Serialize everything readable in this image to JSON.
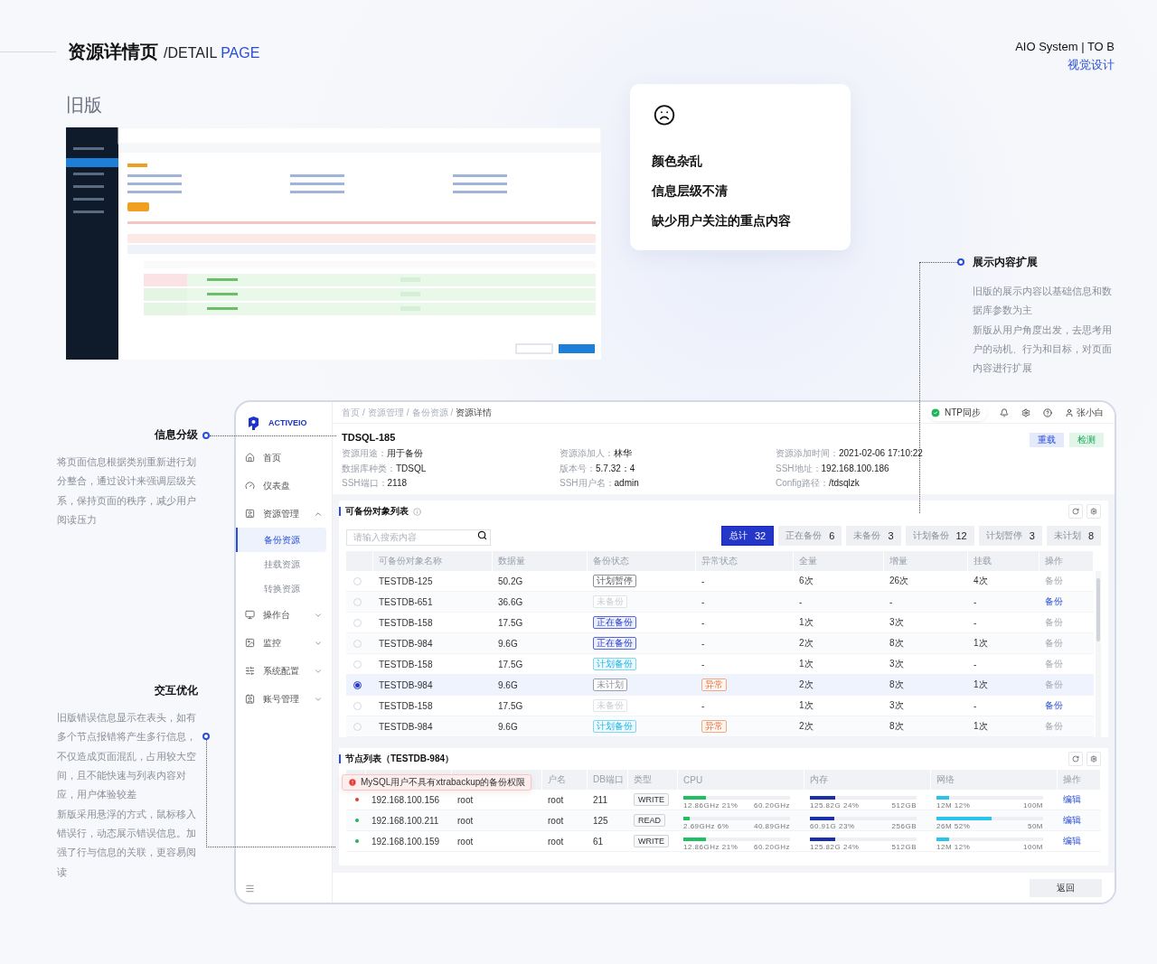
{
  "header": {
    "title": "资源详情页",
    "subtitle": "/DETAIL ",
    "subtitle_accent": "PAGE",
    "brand": "AIO System | TO B",
    "brand_sub": "视觉设计"
  },
  "old_version": {
    "label": "旧版"
  },
  "pain_points": [
    "颜色杂乱",
    "信息层级不清",
    "缺少用户关注的重点内容"
  ],
  "annotations": [
    {
      "title": "展示内容扩展",
      "paragraphs": [
        "旧版的展示内容以基础信息和数据库参数为主",
        "新版从用户角度出发，去思考用户的动机、行为和目标，对页面内容进行扩展"
      ]
    },
    {
      "title": "信息分级",
      "paragraphs": [
        "将页面信息根据类别重新进行划分整合，通过设计来强调层级关系，保持页面的秩序，减少用户阅读压力"
      ]
    },
    {
      "title": "交互优化",
      "paragraphs": [
        "旧版错误信息显示在表头，如有多个节点报错将产生多行信息，不仅造成页面混乱，占用较大空间，且不能快速与列表内容对应，用户体验较差",
        "新版采用悬浮的方式，鼠标移入错误行，动态展示错误信息。加强了行与信息的关联，更容易阅读"
      ]
    }
  ],
  "app": {
    "logo": "ACTIVEIO",
    "nav": [
      {
        "label": "首页",
        "kind": "item"
      },
      {
        "label": "仪表盘",
        "kind": "item"
      },
      {
        "label": "资源管理",
        "kind": "group",
        "expanded": true,
        "children": [
          {
            "label": "备份资源",
            "selected": true
          },
          {
            "label": "挂载资源",
            "selected": false
          },
          {
            "label": "转换资源",
            "selected": false
          }
        ]
      },
      {
        "label": "操作台",
        "kind": "group",
        "expanded": false
      },
      {
        "label": "监控",
        "kind": "group",
        "expanded": false
      },
      {
        "label": "系统配置",
        "kind": "group",
        "expanded": false
      },
      {
        "label": "账号管理",
        "kind": "group",
        "expanded": false
      }
    ],
    "breadcrumb": {
      "separator": "/",
      "items": [
        "首页",
        "资源管理",
        "备份资源",
        "资源详情"
      ]
    },
    "topbar": {
      "ntp": "NTP同步",
      "user": "张小白"
    },
    "resource": {
      "title": "TDSQL-185",
      "fields": [
        {
          "label": "资源用途：",
          "value": "用于备份"
        },
        {
          "label": "资源添加人：",
          "value": "林华"
        },
        {
          "label": "资源添加时间：",
          "value": "2021-02-06 17:10:22"
        },
        {
          "label": "数据库种类：",
          "value": "TDSQL"
        },
        {
          "label": "版本号：",
          "value": "5.7.32：4"
        },
        {
          "label": "SSH地址：",
          "value": "192.168.100.186"
        },
        {
          "label": "SSH端口：",
          "value": "2118"
        },
        {
          "label": "SSH用户名：",
          "value": "admin"
        },
        {
          "label": "Config路径：",
          "value": "/tdsqlzk"
        }
      ],
      "actions": [
        {
          "label": "重载",
          "kind": "primary"
        },
        {
          "label": "检测",
          "kind": "success"
        }
      ]
    },
    "backup_list": {
      "title": "可备份对象列表",
      "search": {
        "placeholder": "请输入搜索内容"
      },
      "filters": [
        {
          "label": "总计",
          "count": "32",
          "selected": true
        },
        {
          "label": "正在备份",
          "count": "6",
          "selected": false
        },
        {
          "label": "未备份",
          "count": "3",
          "selected": false
        },
        {
          "label": "计划备份",
          "count": "12",
          "selected": false
        },
        {
          "label": "计划暂停",
          "count": "3",
          "selected": false
        },
        {
          "label": "未计划",
          "count": "8",
          "selected": false
        }
      ],
      "columns": [
        "可备份对象名称",
        "数据量",
        "备份状态",
        "异常状态",
        "全量",
        "增量",
        "挂载",
        "操作"
      ],
      "rows": [
        {
          "selected": false,
          "name": "TESTDB-125",
          "size": "50.2G",
          "status": {
            "label": "计划暂停",
            "kind": "paused"
          },
          "anomaly": {
            "label": "-",
            "kind": "text"
          },
          "full": "6次",
          "inc": "26次",
          "mount": "4次",
          "action": {
            "label": "备份",
            "disabled": true
          }
        },
        {
          "selected": false,
          "name": "TESTDB-651",
          "size": "36.6G",
          "status": {
            "label": "未备份",
            "kind": "none"
          },
          "anomaly": {
            "label": "-",
            "kind": "text"
          },
          "full": "-",
          "inc": "-",
          "mount": "-",
          "action": {
            "label": "备份",
            "disabled": false
          }
        },
        {
          "selected": false,
          "name": "TESTDB-158",
          "size": "17.5G",
          "status": {
            "label": "正在备份",
            "kind": "running"
          },
          "anomaly": {
            "label": "-",
            "kind": "text"
          },
          "full": "1次",
          "inc": "3次",
          "mount": "-",
          "action": {
            "label": "备份",
            "disabled": true
          }
        },
        {
          "selected": false,
          "name": "TESTDB-984",
          "size": "9.6G",
          "status": {
            "label": "正在备份",
            "kind": "running"
          },
          "anomaly": {
            "label": "-",
            "kind": "text"
          },
          "full": "2次",
          "inc": "8次",
          "mount": "1次",
          "action": {
            "label": "备份",
            "disabled": true
          }
        },
        {
          "selected": false,
          "name": "TESTDB-158",
          "size": "17.5G",
          "status": {
            "label": "计划备份",
            "kind": "planned"
          },
          "anomaly": {
            "label": "-",
            "kind": "text"
          },
          "full": "1次",
          "inc": "3次",
          "mount": "-",
          "action": {
            "label": "备份",
            "disabled": true
          }
        },
        {
          "selected": true,
          "name": "TESTDB-984",
          "size": "9.6G",
          "status": {
            "label": "未计划",
            "kind": "unplanned"
          },
          "anomaly": {
            "label": "异常",
            "kind": "tag"
          },
          "full": "2次",
          "inc": "8次",
          "mount": "1次",
          "action": {
            "label": "备份",
            "disabled": true
          }
        },
        {
          "selected": false,
          "name": "TESTDB-158",
          "size": "17.5G",
          "status": {
            "label": "未备份",
            "kind": "none"
          },
          "anomaly": {
            "label": "-",
            "kind": "text"
          },
          "full": "1次",
          "inc": "3次",
          "mount": "-",
          "action": {
            "label": "备份",
            "disabled": false
          }
        },
        {
          "selected": false,
          "name": "TESTDB-984",
          "size": "9.6G",
          "status": {
            "label": "计划备份",
            "kind": "planned"
          },
          "anomaly": {
            "label": "异常",
            "kind": "tag"
          },
          "full": "2次",
          "inc": "8次",
          "mount": "1次",
          "action": {
            "label": "备份",
            "disabled": true
          }
        }
      ]
    },
    "node_list": {
      "title": "节点列表（TESTDB-984）",
      "tooltip": "MySQL用户不具有xtrabackup的备份权限",
      "columns": [
        "户名",
        "DB端口",
        "类型",
        "CPU",
        "内存",
        "网络",
        "操作"
      ],
      "rows": [
        {
          "color": "#e53935",
          "ip": "192.168.100.156",
          "user": "root",
          "db_user": "root",
          "port": "211",
          "type": "WRITE",
          "cpu": {
            "level": 0.21,
            "used": "12.86GHz",
            "pct": "21%",
            "total": "60.20GHz"
          },
          "mem": {
            "level": 0.24,
            "used": "125.82G",
            "pct": "24%",
            "total": "512GB"
          },
          "net": {
            "level": 0.12,
            "used": "12M",
            "pct": "12%",
            "total": "100M"
          },
          "action": "编辑"
        },
        {
          "color": "#22b35e",
          "ip": "192.168.100.211",
          "user": "root",
          "db_user": "root",
          "port": "125",
          "type": "READ",
          "cpu": {
            "level": 0.06,
            "used": "2.69GHz",
            "pct": "6%",
            "total": "40.89GHz"
          },
          "mem": {
            "level": 0.23,
            "used": "60.91G",
            "pct": "23%",
            "total": "256GB"
          },
          "net": {
            "level": 0.52,
            "used": "26M",
            "pct": "52%",
            "total": "50M"
          },
          "action": "编辑"
        },
        {
          "color": "#22b35e",
          "ip": "192.168.100.159",
          "user": "root",
          "db_user": "root",
          "port": "61",
          "type": "WRITE",
          "cpu": {
            "level": 0.21,
            "used": "12.86GHz",
            "pct": "21%",
            "total": "60.20GHz"
          },
          "mem": {
            "level": 0.24,
            "used": "125.82G",
            "pct": "24%",
            "total": "512GB"
          },
          "net": {
            "level": 0.12,
            "used": "12M",
            "pct": "12%",
            "total": "100M"
          },
          "action": "编辑"
        }
      ]
    },
    "footer": {
      "back": "返回"
    }
  }
}
